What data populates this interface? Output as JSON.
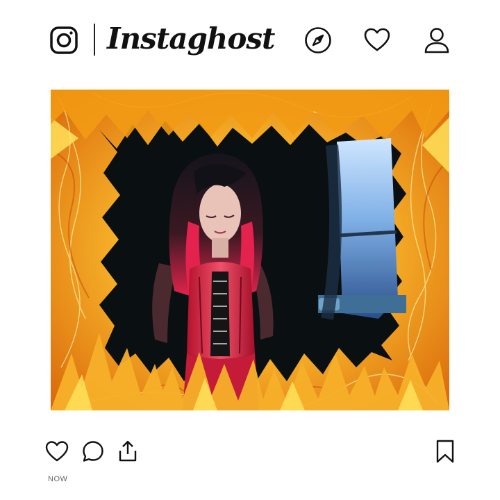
{
  "header": {
    "brand": "Instaghost",
    "icons": [
      "instagram-icon",
      "compass-icon",
      "heart-icon",
      "profile-icon"
    ]
  },
  "post": {
    "image_description_icon": "photo",
    "timestamp": "NOW",
    "actions": [
      "like-icon",
      "comment-icon",
      "share-icon",
      "bookmark-icon"
    ]
  },
  "colors": {
    "ink": "#111111",
    "flame_outer": "#f39a12",
    "flame_inner": "#ffe35a",
    "hair_red": "#e0254a",
    "window_blue": "#5c8fcf"
  }
}
